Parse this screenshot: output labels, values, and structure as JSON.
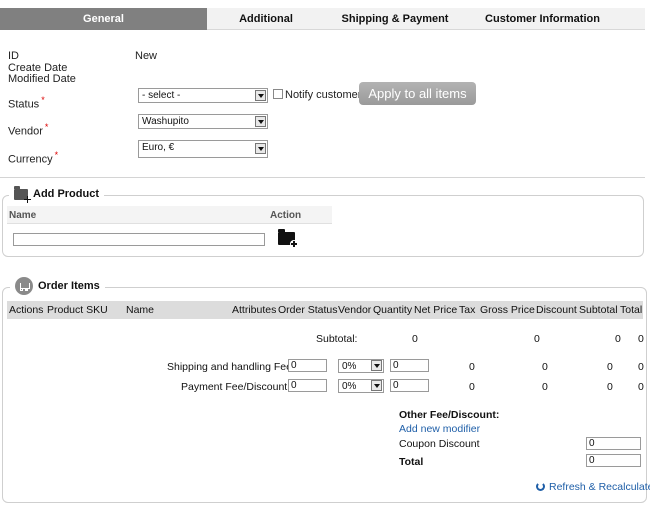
{
  "tabs": {
    "general": "General",
    "additional": "Additional",
    "shipping": "Shipping & Payment",
    "customer": "Customer Information"
  },
  "general": {
    "id_label": "ID",
    "id_value": "New",
    "create_date_label": "Create Date",
    "modified_date_label": "Modified Date",
    "status_label": "Status",
    "status_value": "- select -",
    "notify_label": "Notify customer",
    "apply_button": "Apply to all items",
    "vendor_label": "Vendor",
    "vendor_value": "Washupito",
    "currency_label": "Currency",
    "currency_value": "Euro, €",
    "required_mark": "*"
  },
  "add_product": {
    "legend": "Add Product",
    "col_name": "Name",
    "col_action": "Action",
    "name_value": ""
  },
  "order_items": {
    "legend": "Order Items",
    "columns": [
      "Actions",
      "Product SKU",
      "Name",
      "Attributes",
      "Order Status",
      "Vendor",
      "Quantity",
      "Net Price",
      "Tax",
      "Gross Price",
      "Discount",
      "Subtotal",
      "Total"
    ],
    "subtotal_label": "Subtotal:",
    "subtotal_net": "0",
    "subtotal_gross": "0",
    "subtotal_subtotal": "0",
    "subtotal_total": "0",
    "shipping_label": "Shipping and handling Fee:",
    "shipping_amount": "0",
    "shipping_percent": "0%",
    "shipping_qty": "0",
    "shipping_net": "0",
    "shipping_gross": "0",
    "shipping_subtotal": "0",
    "shipping_total": "0",
    "payment_label": "Payment Fee/Discount:",
    "payment_amount": "0",
    "payment_percent": "0%",
    "payment_qty": "0",
    "payment_net": "0",
    "payment_gross": "0",
    "payment_subtotal": "0",
    "payment_total": "0",
    "other_fee_label": "Other Fee/Discount:",
    "add_modifier_link": "Add new modifier",
    "coupon_label": "Coupon Discount",
    "coupon_value": "0",
    "total_label": "Total",
    "total_value": "0",
    "refresh_link": "Refresh & Recalculate"
  }
}
